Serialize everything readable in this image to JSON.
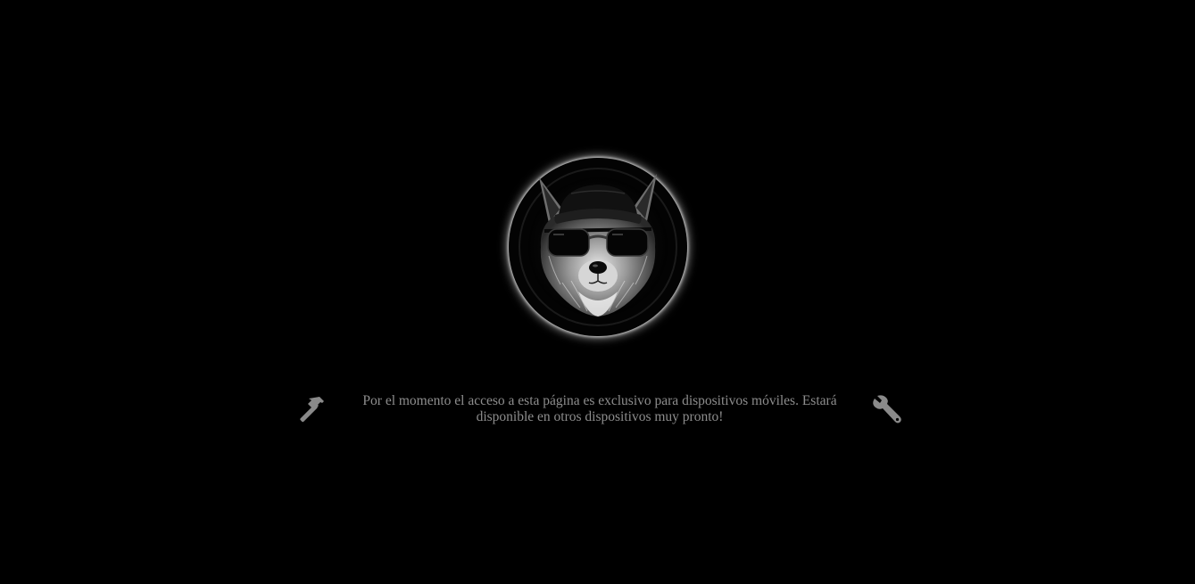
{
  "logo": {
    "icon": "raccoon-with-cap-and-sunglasses-logo"
  },
  "notice": {
    "message": "Por el momento el acceso a esta página es exclusivo para dispositivos móviles. Estará disponible en otros dispositivos muy pronto!",
    "left_icon": "hammer-icon",
    "right_icon": "wrench-icon"
  },
  "colors": {
    "background": "#000000",
    "text": "#8d8d8d",
    "icon": "#8a8a8a",
    "glow": "#ffffff"
  }
}
